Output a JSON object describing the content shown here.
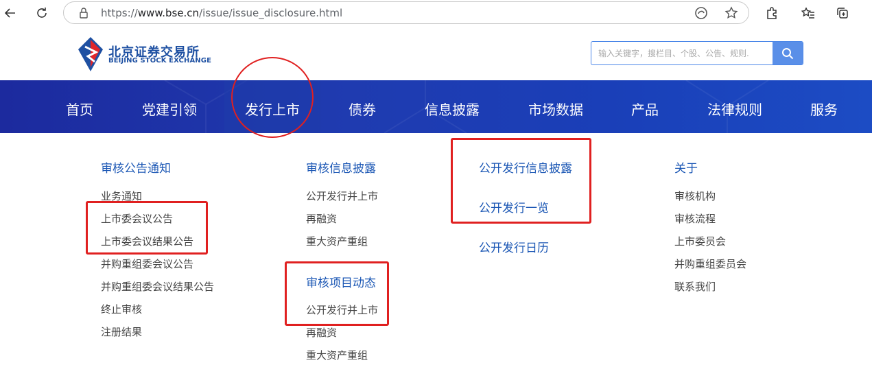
{
  "browser": {
    "url_scheme": "https://",
    "url_host": "www.bse.cn",
    "url_path": "/issue/issue_disclosure.html"
  },
  "header": {
    "logo_cn": "北京证券交易所",
    "logo_en": "BEIJING STOCK EXCHANGE",
    "search_placeholder": "输入关键字，搜栏目、个股、公告、规则."
  },
  "nav": {
    "items": [
      "首页",
      "党建引领",
      "发行上市",
      "债券",
      "信息披露",
      "市场数据",
      "产品",
      "法律规则",
      "服务"
    ],
    "active": "发行上市"
  },
  "menu": {
    "col1": {
      "title": "审核公告通知",
      "links": [
        "业务通知",
        "上市委会议公告",
        "上市委会议结果公告",
        "并购重组委会议公告",
        "并购重组委会议结果公告",
        "终止审核",
        "注册结果"
      ]
    },
    "col2": {
      "title": "审核信息披露",
      "links": [
        "公开发行并上市",
        "再融资",
        "重大资产重组"
      ],
      "title2": "审核项目动态",
      "links2": [
        "公开发行并上市",
        "再融资",
        "重大资产重组"
      ]
    },
    "col3": {
      "titles": [
        "公开发行信息披露",
        "公开发行一览",
        "公开发行日历"
      ]
    },
    "col4": {
      "title": "关于",
      "links": [
        "审核机构",
        "审核流程",
        "上市委员会",
        "并购重组委员会",
        "联系我们"
      ]
    }
  },
  "colors": {
    "nav_bg": "#1f3bb0",
    "menu_title": "#1a56b4",
    "annotation": "#e02020"
  }
}
